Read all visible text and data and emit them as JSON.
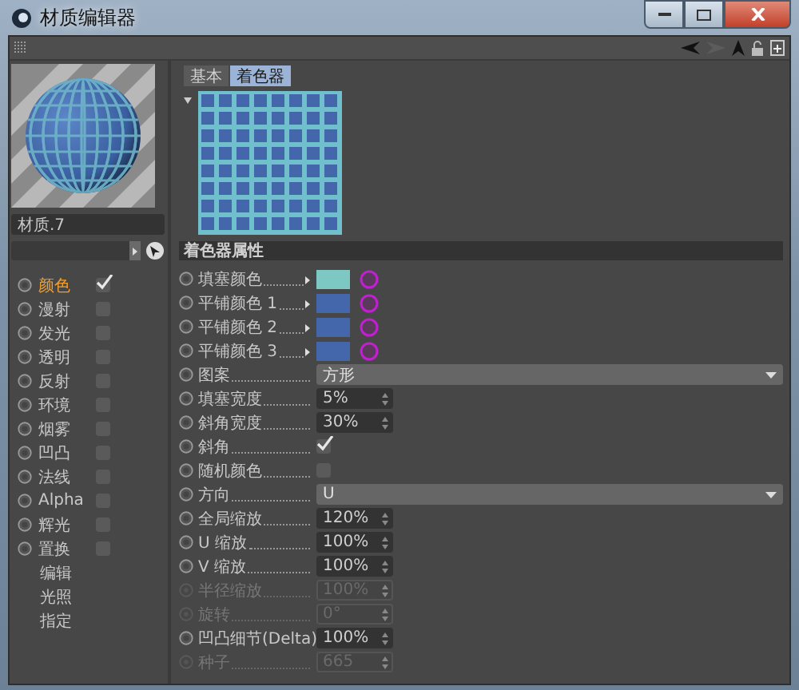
{
  "window": {
    "title": "材质编辑器"
  },
  "nav_buttons": [
    {
      "kind": "back",
      "disabled": false
    },
    {
      "kind": "forward",
      "disabled": true
    },
    {
      "kind": "up",
      "disabled": false
    }
  ],
  "material": {
    "name": "材质.7"
  },
  "channels": [
    {
      "kind": "channel",
      "label": "颜色",
      "selected": true,
      "checked": true
    },
    {
      "kind": "channel",
      "label": "漫射",
      "selected": false,
      "checked": false
    },
    {
      "kind": "channel",
      "label": "发光",
      "selected": false,
      "checked": false
    },
    {
      "kind": "channel",
      "label": "透明",
      "selected": false,
      "checked": false
    },
    {
      "kind": "channel",
      "label": "反射",
      "selected": false,
      "checked": false
    },
    {
      "kind": "channel",
      "label": "环境",
      "selected": false,
      "checked": false
    },
    {
      "kind": "channel",
      "label": "烟雾",
      "selected": false,
      "checked": false
    },
    {
      "kind": "channel",
      "label": "凹凸",
      "selected": false,
      "checked": false
    },
    {
      "kind": "channel",
      "label": "法线",
      "selected": false,
      "checked": false
    },
    {
      "kind": "channel",
      "label": "Alpha",
      "selected": false,
      "checked": false
    },
    {
      "kind": "channel",
      "label": "辉光",
      "selected": false,
      "checked": false
    },
    {
      "kind": "channel",
      "label": "置换",
      "selected": false,
      "checked": false
    },
    {
      "kind": "page",
      "label": "编辑",
      "selected": false
    },
    {
      "kind": "page",
      "label": "光照",
      "selected": false
    },
    {
      "kind": "page",
      "label": "指定",
      "selected": false
    }
  ],
  "tabs": [
    {
      "label": "基本",
      "selected": false
    },
    {
      "label": "着色器",
      "selected": true
    }
  ],
  "section": {
    "title": "着色器属性"
  },
  "params": [
    {
      "kind": "color",
      "label": "填塞颜色",
      "color": "#7ec8c4",
      "disabled": false
    },
    {
      "kind": "color",
      "label": "平铺颜色 1",
      "color": "#4466aa",
      "disabled": false
    },
    {
      "kind": "color",
      "label": "平铺颜色 2",
      "color": "#4466aa",
      "disabled": false
    },
    {
      "kind": "color",
      "label": "平铺颜色 3",
      "color": "#4466aa",
      "disabled": false
    },
    {
      "kind": "dropdown",
      "label": "图案",
      "value": "方形",
      "disabled": false
    },
    {
      "kind": "number",
      "label": "填塞宽度",
      "value": "5%",
      "disabled": false
    },
    {
      "kind": "number",
      "label": "斜角宽度",
      "value": "30%",
      "disabled": false
    },
    {
      "kind": "checkbox",
      "label": "斜角",
      "checked": true,
      "disabled": false
    },
    {
      "kind": "checkbox",
      "label": "随机颜色",
      "checked": false,
      "disabled": false
    },
    {
      "kind": "dropdown",
      "label": "方向",
      "value": "U",
      "disabled": false
    },
    {
      "kind": "number",
      "label": "全局缩放",
      "value": "120%",
      "disabled": false
    },
    {
      "kind": "number",
      "label": "U 缩放",
      "value": "100%",
      "disabled": false
    },
    {
      "kind": "number",
      "label": "V 缩放",
      "value": "100%",
      "disabled": false
    },
    {
      "kind": "number",
      "label": "半径缩放",
      "value": "100%",
      "disabled": true
    },
    {
      "kind": "number",
      "label": "旋转",
      "value": "0°",
      "disabled": true
    },
    {
      "kind": "number",
      "label": "凹凸细节(Delta)",
      "value": "100%",
      "disabled": false
    },
    {
      "kind": "number",
      "label": "种子",
      "value": "665",
      "disabled": true
    }
  ]
}
